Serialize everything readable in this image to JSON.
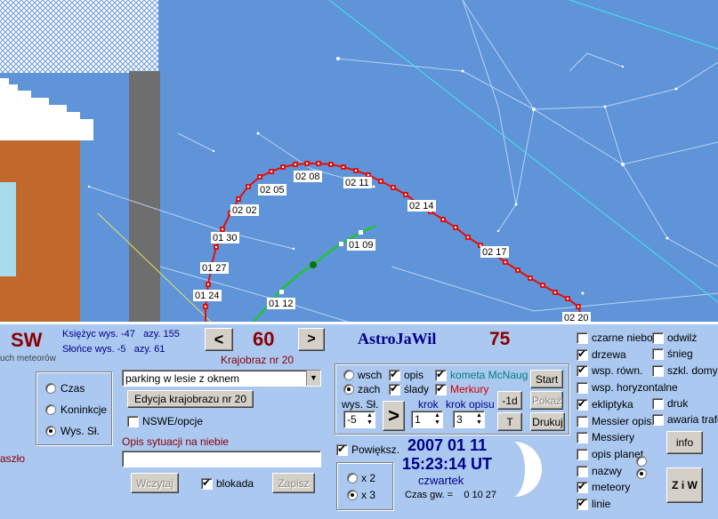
{
  "sky": {
    "date_labels": [
      "02 20",
      "02 17",
      "02 14",
      "02 11",
      "02 08",
      "02 05",
      "02 02",
      "01 30",
      "01 27",
      "01 24",
      "01 09",
      "01 12"
    ],
    "meteors_caption": "uch meteorów",
    "cut_label": "aszło"
  },
  "status": {
    "direction": "SW",
    "moon_line": "Księżyc wys. -47   azy. 155",
    "sun_line": "Słońce wys. -5   azy. 61",
    "prev_label": "<",
    "value": "60",
    "next_label": ">",
    "app_title": "AstroJaWil",
    "counter": "75",
    "landscape_caption": "Krajobraz nr 20"
  },
  "mode": {
    "options": [
      {
        "label": "Czas",
        "checked": false
      },
      {
        "label": "Koninkcje",
        "checked": false
      },
      {
        "label": "Wys. Sł.",
        "checked": true
      }
    ]
  },
  "landscape": {
    "select_value": "parking w lesie z oknem",
    "edit_button": "Edycja krajobrazu nr 20",
    "nswe_label": "NSWE/opcje",
    "nswe_checked": false,
    "desc_caption": "Opis sytuacji na niebie",
    "desc_value": "",
    "load_button": "Wczytaj",
    "lock_label": "blokada",
    "lock_checked": true,
    "save_button": "Zapisz"
  },
  "objects": {
    "wsch_label": "wsch",
    "zach_label": "zach",
    "wsch_checked": false,
    "zach_checked": true,
    "opis_label": "opis",
    "opis_checked": true,
    "slady_label": "ślady",
    "slady_checked": true,
    "comet_label": "kometa McNaug",
    "comet_checked": true,
    "comet_color": "#008080",
    "mercury_label": "Merkury",
    "mercury_checked": true,
    "mercury_color": "#d00000",
    "height_caption": "wys. Sł.",
    "height_value": "-5",
    "step_caption": "krok",
    "step_value": "1",
    "desc_step_caption": "krok opisu",
    "desc_step_value": "3",
    "go_label": ">",
    "start_button": "Start",
    "back_button": "-1d",
    "show_button": "Pokaż",
    "t_button": "T",
    "print_button": "Drukuj"
  },
  "zoom": {
    "label": "Powiększ.",
    "checked": true,
    "x2_label": "x 2",
    "x3_label": "x 3",
    "x2_checked": false,
    "x3_checked": true
  },
  "time": {
    "date": "2007 01 11",
    "clock": "15:23:14 UT",
    "weekday": "czwartek",
    "sidereal": "Czas gw. =    0 10 27"
  },
  "toggles": {
    "left": [
      {
        "label": "czarne niebo",
        "checked": false
      },
      {
        "label": "drzewa",
        "checked": true
      },
      {
        "label": "wsp. równ.",
        "checked": true
      },
      {
        "label": "wsp. horyzontalne",
        "checked": false
      },
      {
        "label": "ekliptyka",
        "checked": true
      },
      {
        "label": "Messier opis",
        "checked": false
      },
      {
        "label": "Messiery",
        "checked": false
      },
      {
        "label": "opis planet",
        "checked": false
      },
      {
        "label": "nazwy",
        "checked": false
      },
      {
        "label": "meteory",
        "checked": true
      },
      {
        "label": "linie",
        "checked": true
      }
    ],
    "right": [
      {
        "label": "odwilż",
        "checked": false
      },
      {
        "label": "śnieg",
        "checked": false
      },
      {
        "label": "szkl. domy",
        "checked": false
      },
      {
        "label": "druk",
        "checked": false
      },
      {
        "label": "awaria trafo",
        "checked": false
      }
    ],
    "info_button": "info",
    "ziw_button": "Z i W"
  },
  "colors": {
    "sky": "#5f94d8",
    "panel": "#aac8f0",
    "mercury_track": "#e01010",
    "comet_track": "#10d010",
    "title_blue": "#00008b",
    "title_red": "#8b0000"
  }
}
